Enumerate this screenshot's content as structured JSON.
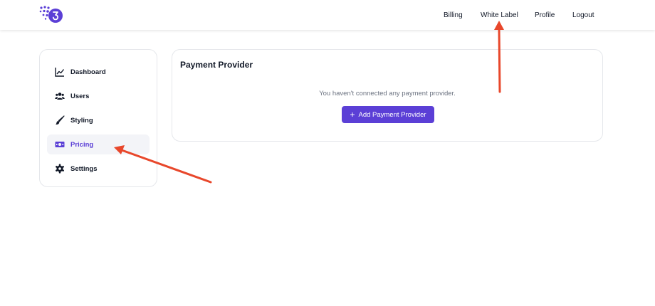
{
  "nav": {
    "billing": "Billing",
    "white_label": "White Label",
    "profile": "Profile",
    "logout": "Logout"
  },
  "sidebar": {
    "items": [
      {
        "label": "Dashboard",
        "icon": "chart-line-icon"
      },
      {
        "label": "Users",
        "icon": "users-icon"
      },
      {
        "label": "Styling",
        "icon": "paintbrush-icon"
      },
      {
        "label": "Pricing",
        "icon": "money-bill-icon",
        "active": true
      },
      {
        "label": "Settings",
        "icon": "gear-icon"
      }
    ]
  },
  "panel": {
    "title": "Payment Provider",
    "empty_message": "You haven't connected any payment provider.",
    "add_button": "Add Payment Provider"
  },
  "colors": {
    "accent": "#5b3fd6",
    "annotation_arrow": "#e8472b",
    "active_item_bg": "#f3f4f8"
  }
}
